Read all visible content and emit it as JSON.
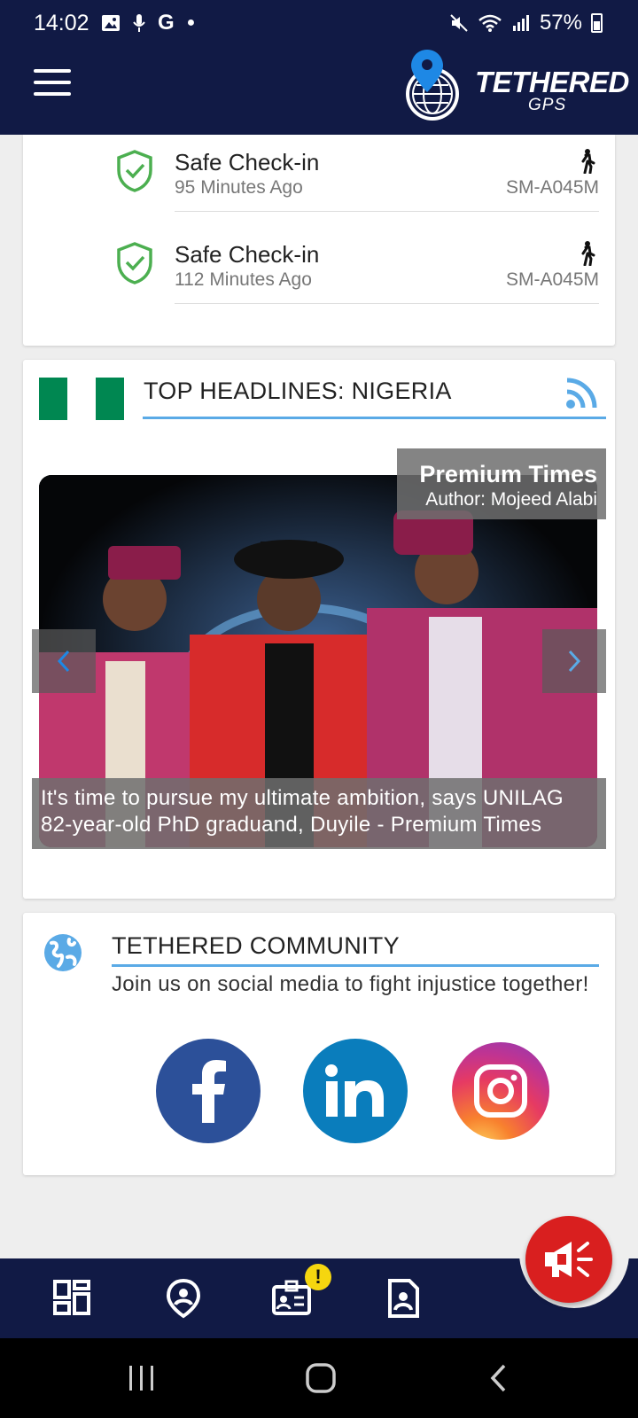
{
  "status_bar": {
    "time": "14:02",
    "left_icons": [
      "gallery-icon",
      "mic-icon",
      "google-icon",
      "dot-icon"
    ],
    "right_icons": [
      "mute-icon",
      "wifi-icon",
      "signal-icon"
    ],
    "battery": "57%"
  },
  "header": {
    "logo_title": "TETHERED",
    "logo_subtitle": "GPS",
    "brand_color": "#111a45",
    "pin_color": "#1e88e5"
  },
  "checkins": [
    {
      "title": "Safe Check-in",
      "time": "95 Minutes Ago",
      "device": "SM-A045M",
      "icon": "walking-icon"
    },
    {
      "title": "Safe Check-in",
      "time": "112 Minutes Ago",
      "device": "SM-A045M",
      "icon": "walking-icon"
    }
  ],
  "headlines": {
    "title": "TOP HEADLINES: NIGERIA",
    "flag_colors": [
      "#008751",
      "#ffffff",
      "#008751"
    ],
    "source": "Premium Times",
    "author": "Author: Mojeed Alabi",
    "caption": "It's time to pursue my ultimate ambition, says UNILAG 82-year-old PhD graduand, Duyile - Premium Times"
  },
  "community": {
    "title": "TETHERED COMMUNITY",
    "subtitle": "Join us on social media to fight injustice together!",
    "socials": [
      "facebook-icon",
      "linkedin-icon",
      "instagram-icon"
    ]
  },
  "bottom_nav": {
    "items": [
      "dashboard-icon",
      "location-icon",
      "id-card-icon",
      "document-icon"
    ],
    "badge": "!",
    "sos_color": "#d91f1f"
  }
}
